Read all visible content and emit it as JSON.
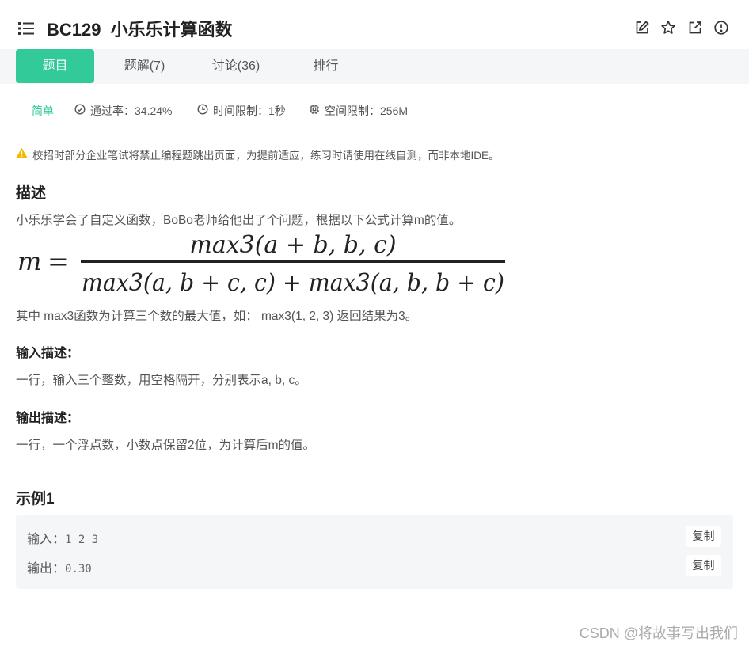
{
  "header": {
    "code": "BC129",
    "name": "小乐乐计算函数",
    "icons": [
      "list-icon",
      "edit-icon",
      "star-icon",
      "external-link-icon",
      "alert-icon"
    ]
  },
  "tabs": [
    {
      "label": "题目",
      "active": true
    },
    {
      "label": "题解(7)",
      "active": false
    },
    {
      "label": "讨论(36)",
      "active": false
    },
    {
      "label": "排行",
      "active": false
    }
  ],
  "meta": {
    "level": "简单",
    "pass_rate": "通过率：34.24%",
    "time_limit": "时间限制：1秒",
    "space_limit": "空间限制：256M"
  },
  "notice": "校招时部分企业笔试将禁止编程题跳出页面，为提前适应，练习时请使用在线自测，而非本地IDE。",
  "description": {
    "heading": "描述",
    "intro": "小乐乐学会了自定义函数，BoBo老师给他出了个问题，根据以下公式计算m的值。",
    "formula": {
      "lhs": "m",
      "eq": "=",
      "numerator": "max3(a + b, b, c)",
      "denominator": "max3(a, b + c, c) + max3(a, b, b + c)"
    },
    "note": "其中 max3函数为计算三个数的最大值，如： max3(1, 2, 3) 返回结果为3。"
  },
  "input_desc": {
    "heading": "输入描述：",
    "text": "一行，输入三个整数，用空格隔开，分别表示a, b, c。"
  },
  "output_desc": {
    "heading": "输出描述：",
    "text": "一行，一个浮点数，小数点保留2位，为计算后m的值。"
  },
  "example": {
    "heading": "示例1",
    "input_label": "输入：",
    "input_value": "1 2 3",
    "output_label": "输出：",
    "output_value": "0.30",
    "copy_label": "复制"
  },
  "watermark": "CSDN @将故事写出我们",
  "colors": {
    "accent": "#32ca99",
    "tab_bg": "#f5f6f8",
    "warn": "#f5b800"
  }
}
